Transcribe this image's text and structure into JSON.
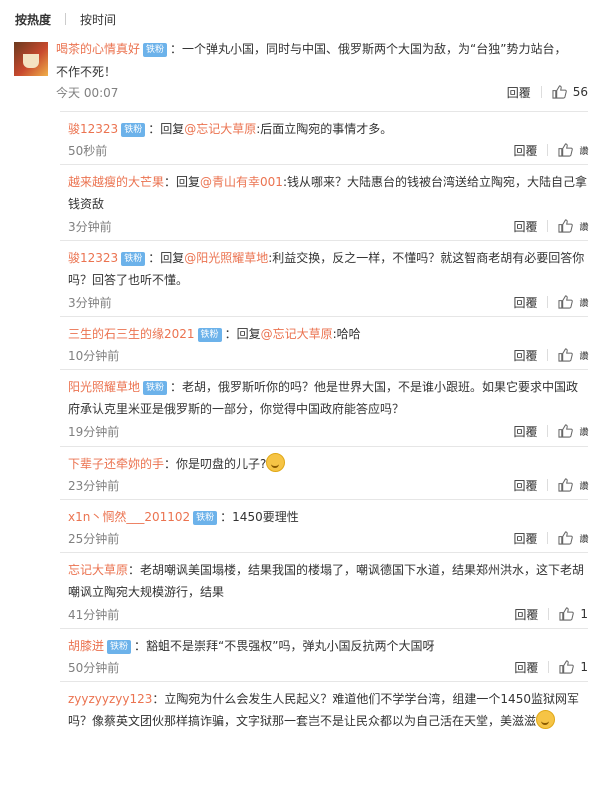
{
  "sort": {
    "hot": "按热度",
    "time": "按时间"
  },
  "root": {
    "user": "喝茶的心情真好",
    "badge": "铁粉",
    "text": "：一个弹丸小国，同时与中国、俄罗斯两个大国为敌，为“台独”势力站台，不作不死！",
    "time": "今天 00:07",
    "reply": "回覆",
    "likes": "56"
  },
  "replies": [
    {
      "user": "骏12323",
      "badge": "铁粉",
      "pre": "：回复",
      "mention": "@忘记大草原",
      "text": ":后面立陶宛的事情才多。",
      "time": "50秒前",
      "reply": "回覆",
      "like": "讚"
    },
    {
      "user": "越来越瘦的大芒果",
      "badge": "",
      "pre": "：回复",
      "mention": "@青山有幸001",
      "text": ":钱从哪来？大陆惠台的钱被台湾送给立陶宛，大陆自己拿钱资敌",
      "time": "3分钟前",
      "reply": "回覆",
      "like": "讚"
    },
    {
      "user": "骏12323",
      "badge": "铁粉",
      "pre": "：回复",
      "mention": "@阳光照耀草地",
      "text": ":利益交换，反之一样，不懂吗？就这智商老胡有必要回答你吗？回答了也听不懂。",
      "time": "3分钟前",
      "reply": "回覆",
      "like": "讚"
    },
    {
      "user": "三生的石三生的缘2021",
      "badge": "铁粉",
      "pre": "：回复",
      "mention": "@忘记大草原",
      "text": ":哈哈",
      "time": "10分钟前",
      "reply": "回覆",
      "like": "讚"
    },
    {
      "user": "阳光照耀草地",
      "badge": "铁粉",
      "pre": "：老胡，俄罗斯听你的吗？他是世界大国，不是谁小跟班。如果它要求中国政府承认克里米亚是俄罗斯的一部分，你觉得中国政府能答应吗？",
      "mention": "",
      "text": "",
      "time": "19分钟前",
      "reply": "回覆",
      "like": "讚"
    },
    {
      "user": "下辈子还牵妳的手",
      "badge": "",
      "pre": "：你是叨盘的儿子?",
      "mention": "",
      "text": "",
      "time": "23分钟前",
      "reply": "回覆",
      "like": "讚",
      "emoji": "smile-emoji"
    },
    {
      "user": "x1n丶惘然___201102",
      "badge": "铁粉",
      "pre": "：1450要理性",
      "mention": "",
      "text": "",
      "time": "25分钟前",
      "reply": "回覆",
      "like": "讚"
    },
    {
      "user": "忘记大草原",
      "badge": "",
      "pre": "：老胡嘲讽美国塌楼，结果我国的楼塌了，嘲讽德国下水道，结果郑州洪水，这下老胡嘲讽立陶宛大规模游行，结果",
      "mention": "",
      "text": "",
      "time": "41分钟前",
      "reply": "回覆",
      "like": "1"
    },
    {
      "user": "胡膝迸",
      "badge": "铁粉",
      "pre": "：豁蛆不是崇拜“不畏强权”吗，弹丸小国反抗两个大国呀",
      "mention": "",
      "text": "",
      "time": "50分钟前",
      "reply": "回覆",
      "like": "1"
    },
    {
      "user": "zyyzyyzyy123",
      "badge": "",
      "pre": "：立陶宛为什么会发生人民起义？难道他们不学学台湾，组建一个1450监狱网军吗？像蔡英文团伙那样搞诈骗，文字狱那一套岂不是让民众都以为自己活在天堂，美滋滋",
      "mention": "",
      "text": "",
      "time": "",
      "reply": "",
      "like": "",
      "emoji": "laugh-emoji"
    }
  ]
}
